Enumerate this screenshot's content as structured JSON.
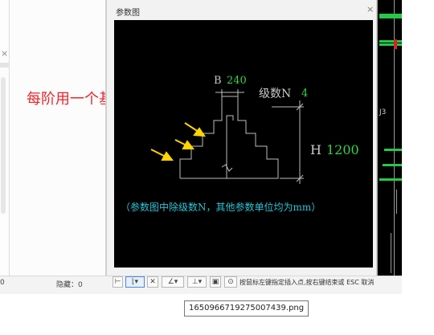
{
  "dialog": {
    "title": "参数图",
    "close_glyph": "×"
  },
  "diagram": {
    "param_b_label": "B",
    "param_b_value": "240",
    "levels_label": "级数N",
    "levels_value": "4",
    "height_label": "H",
    "height_value": "1200",
    "note": "（参数图中除级数N，其他参数单位均为mm）"
  },
  "annotation": "每阶用一个基础单元定义。",
  "status": {
    "left_value": "0",
    "hidden_label": "隐藏：0"
  },
  "toolbar": {
    "hint": "按鼠标左键指定插入点,按右键结束或 ESC 取消"
  },
  "tooltip": "1650966719275007439.png",
  "cad_label": "J3",
  "left_panel_close": "×",
  "colors": {
    "annotation": "#e8262c",
    "dimension_text": "#c8c8c8",
    "param_value": "#35d24a",
    "arrow": "#ffd400",
    "note": "#2ec4d6"
  }
}
